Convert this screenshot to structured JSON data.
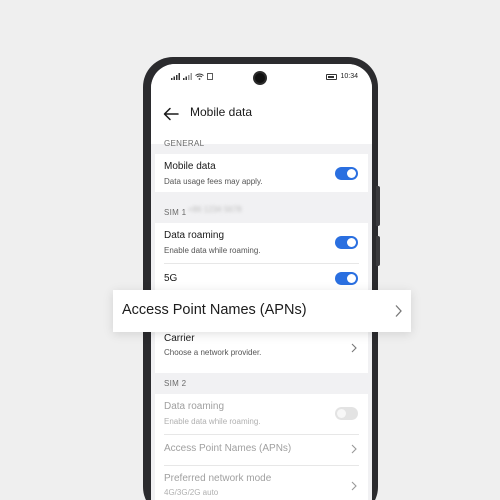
{
  "status_bar": {
    "left_icons": [
      "signal-icon",
      "wifi-icon",
      "notification-icon"
    ],
    "time": "10:34"
  },
  "header": {
    "title": "Mobile data"
  },
  "general": {
    "section_label": "GENERAL",
    "mobile_data": {
      "title": "Mobile data",
      "subtitle": "Data usage fees may apply.",
      "enabled": true
    }
  },
  "sim1": {
    "section_label": "SIM 1",
    "data_roaming": {
      "title": "Data roaming",
      "subtitle": "Enable data while roaming.",
      "enabled": true
    },
    "five_g": {
      "title": "5G",
      "enabled": true
    },
    "apn": {
      "title": "Access Point Names (APNs)"
    },
    "carrier": {
      "title": "Carrier",
      "subtitle": "Choose a network provider."
    }
  },
  "sim2": {
    "section_label": "SIM 2",
    "data_roaming": {
      "title": "Data roaming",
      "subtitle": "Enable data while roaming.",
      "enabled": false
    },
    "apn": {
      "title": "Access Point Names (APNs)"
    },
    "network_mode": {
      "title": "Preferred network mode",
      "subtitle": "4G/3G/2G auto"
    }
  },
  "highlight": {
    "label": "Access Point Names (APNs)"
  },
  "colors": {
    "toggle_on": "#2a6fe0",
    "toggle_off": "#e3e3e3",
    "background": "#efefef"
  }
}
